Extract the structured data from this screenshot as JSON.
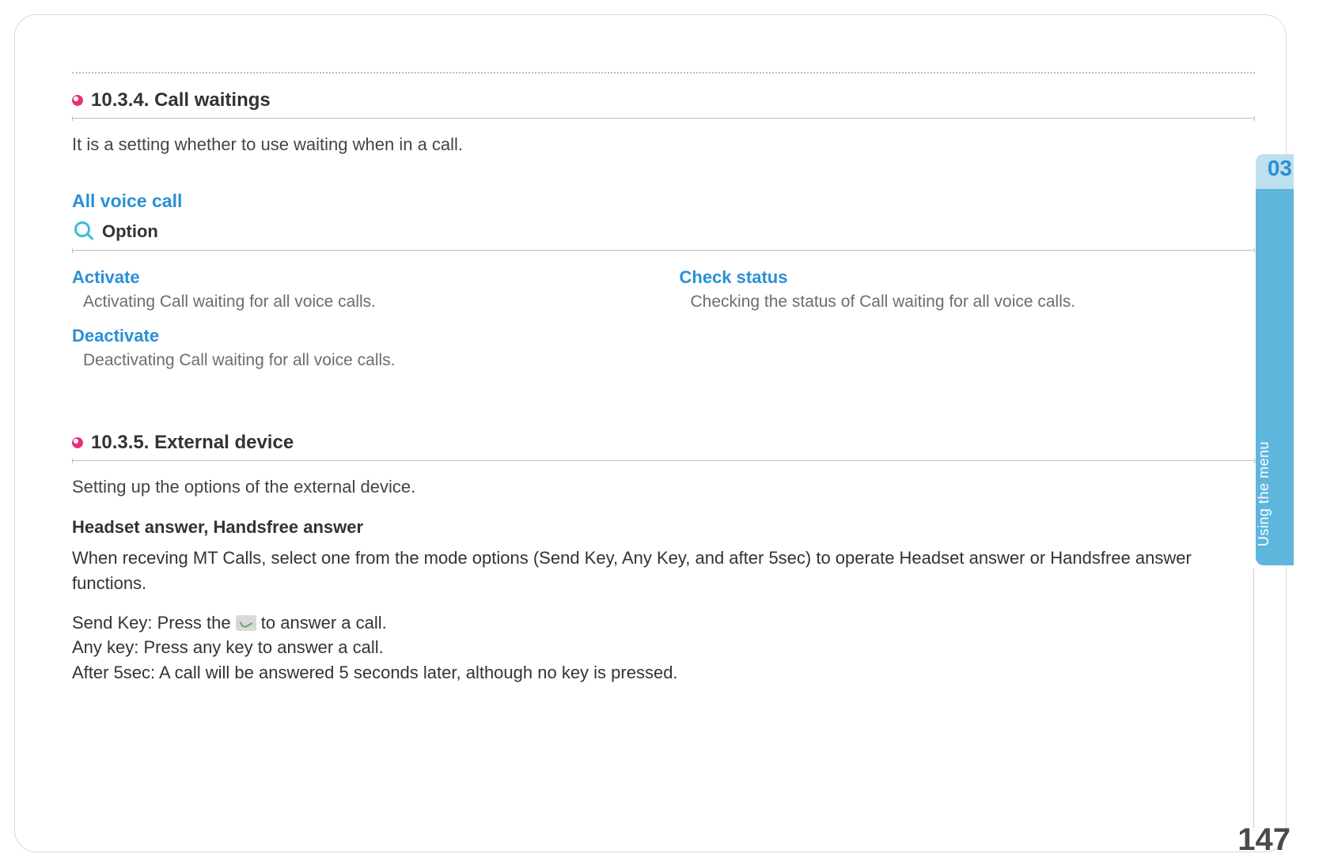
{
  "chapter": {
    "number": "03",
    "label": "Using the menu"
  },
  "page_number": "147",
  "section1": {
    "title": "10.3.4. Call waitings",
    "intro": "It is a setting whether to use waiting when in a call.",
    "subheading": "All voice call",
    "option_heading": "Option",
    "options": {
      "activate": {
        "title": "Activate",
        "desc": "Activating Call waiting for all voice calls."
      },
      "deactivate": {
        "title": "Deactivate",
        "desc": "Deactivating Call waiting for all voice calls."
      },
      "check_status": {
        "title": "Check status",
        "desc": "Checking the status of Call waiting for all voice calls."
      }
    }
  },
  "section2": {
    "title": "10.3.5. External device",
    "intro": "Setting up the options of the external device.",
    "subheading": "Headset answer, Handsfree answer",
    "paragraph": "When receving MT Calls, select one from the mode options (Send Key, Any Key, and after 5sec) to operate Headset answer or Handsfree answer functions.",
    "lines": {
      "send_key_prefix": "Send Key: Press the ",
      "send_key_suffix": " to answer a call.",
      "any_key": "Any key: Press any key to answer a call.",
      "after5": "After 5sec: A call will be answered 5 seconds later, although no key is pressed."
    }
  }
}
